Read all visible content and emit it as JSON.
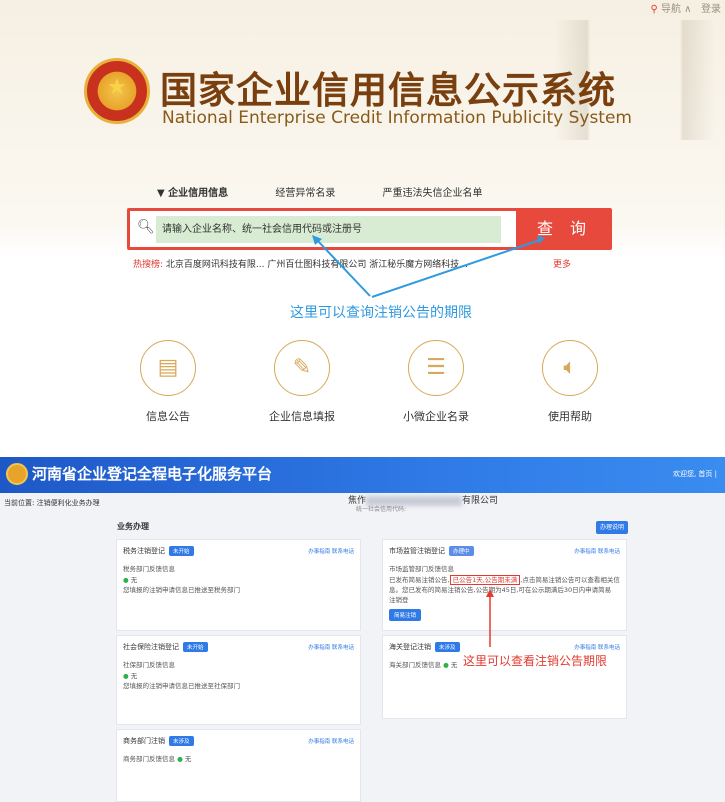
{
  "top": {
    "nav": {
      "nav_label": "导航 ∧",
      "login_label": "登录"
    },
    "title_cn": "国家企业信用信息公示系统",
    "title_en": "National Enterprise Credit Information Publicity System",
    "tabs": [
      "▼ 企业信用信息",
      "经营异常名录",
      "严重违法失信企业名单"
    ],
    "search": {
      "placeholder": "请输入企业名称、统一社会信用代码或注册号",
      "button": "查 询"
    },
    "hot": {
      "label": "热搜榜:",
      "items": "北京百度网讯科技有限...   广州百仕图科技有限公司   浙江秘乐魔方网络科技...",
      "more": "更多"
    },
    "annotation": "这里可以查询注销公告的期限",
    "features": [
      {
        "label": "信息公告",
        "icon": "document-icon"
      },
      {
        "label": "企业信息填报",
        "icon": "pen-icon"
      },
      {
        "label": "小微企业名录",
        "icon": "list-icon"
      },
      {
        "label": "使用帮助",
        "icon": "speaker-icon"
      }
    ]
  },
  "bottom": {
    "header_title": "河南省企业登记全程电子化服务平台",
    "header_right": "欢迎您,        首页  |",
    "location": "当前位置: 注销便利化业务办理",
    "company_tail": "有限公司",
    "company_prefix": "焦作",
    "company_sub": "统一社会信用代码:",
    "section_title": "业务办理",
    "section_btn": "办理说明",
    "annotation": "这里可以查看注销公告期限",
    "cards": [
      {
        "title": "税务注销登记",
        "status": "未开始",
        "links": "办事指南  联系电话",
        "l1": "税务部门反馈信息",
        "l2": "无",
        "l3": "您填报的注销申请信息已推送至税务部门"
      },
      {
        "title": "市场监管注销登记",
        "status": "办理中",
        "links": "办事指南  联系电话",
        "l1": "市场监管部门反馈信息",
        "l2a": "已发布简易注销公告,",
        "l2b": "已公告1天,公告期未满",
        "l2c": ",点击简易注销公告可以查看相关信",
        "l3": "息。您已发布的简易注销公告,公告期为45日,可在公示期满后30日内申请简易注销登",
        "button": "简易注销"
      },
      {
        "title": "社会保险注销登记",
        "status": "未开始",
        "links": "办事指南  联系电话",
        "l1": "社保部门反馈信息",
        "l2": "无",
        "l3": "您填报的注销申请信息已推送至社保部门"
      },
      {
        "title": "海关登记注销",
        "status": "未涉及",
        "links": "办事指南  联系电话",
        "l1": "海关部门反馈信息",
        "l2": "无"
      },
      {
        "title": "商务部门注销",
        "status": "未涉及",
        "links": "办事指南  联系电话",
        "l1": "商务部门反馈信息",
        "l2": "无"
      }
    ]
  }
}
